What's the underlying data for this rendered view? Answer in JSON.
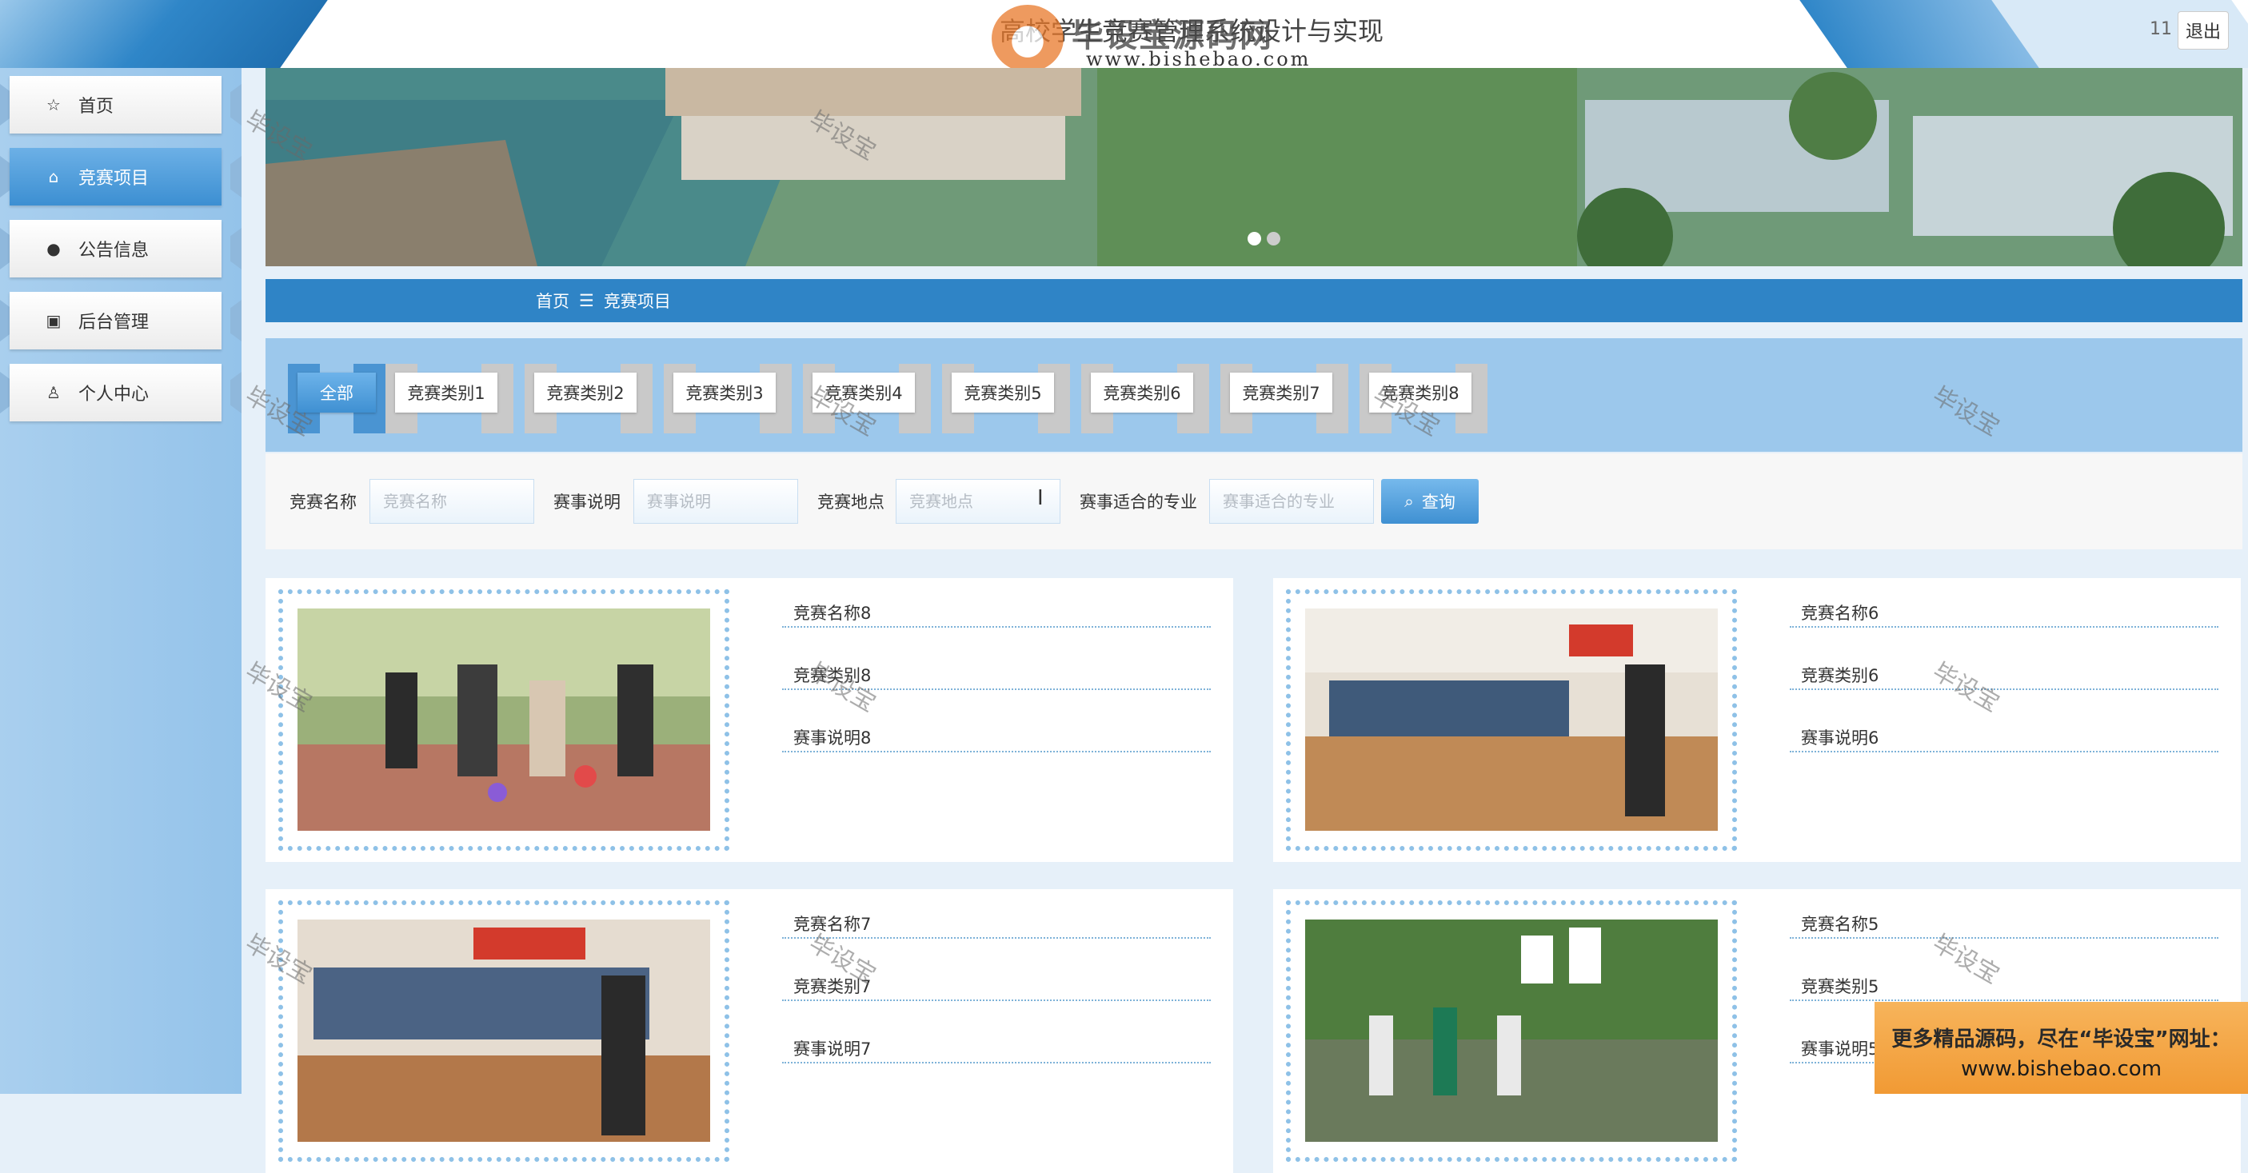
{
  "header": {
    "site_title": "高校学生竞赛管理系统设计与实现",
    "watermark_logo_text": "毕设宝源码网",
    "watermark_url": "www.bishebao.com",
    "user_number": "11",
    "logout_label": "退出"
  },
  "sidebar": {
    "items": [
      {
        "label": "首页",
        "icon": "star-icon"
      },
      {
        "label": "竞赛项目",
        "icon": "bag-icon"
      },
      {
        "label": "公告信息",
        "icon": "alert-icon"
      },
      {
        "label": "后台管理",
        "icon": "briefcase-icon"
      },
      {
        "label": "个人中心",
        "icon": "person-icon"
      }
    ]
  },
  "breadcrumb": {
    "home": "首页",
    "separator": "☰",
    "current": "竞赛项目"
  },
  "categories": [
    "全部",
    "竞赛类别1",
    "竞赛类别2",
    "竞赛类别3",
    "竞赛类别4",
    "竞赛类别5",
    "竞赛类别6",
    "竞赛类别7",
    "竞赛类别8"
  ],
  "search": {
    "name_label": "竞赛名称",
    "name_placeholder": "竞赛名称",
    "desc_label": "赛事说明",
    "desc_placeholder": "赛事说明",
    "place_label": "竞赛地点",
    "place_placeholder": "竞赛地点",
    "major_label": "赛事适合的专业",
    "major_placeholder": "赛事适合的专业",
    "query_label": "查询"
  },
  "cards": [
    {
      "name": "竞赛名称8",
      "category": "竞赛类别8",
      "description": "赛事说明8"
    },
    {
      "name": "竞赛名称6",
      "category": "竞赛类别6",
      "description": "赛事说明6"
    },
    {
      "name": "竞赛名称7",
      "category": "竞赛类别7",
      "description": "赛事说明7"
    },
    {
      "name": "竞赛名称5",
      "category": "竞赛类别5",
      "description": "赛事说明5"
    }
  ],
  "watermark_text": "毕设宝",
  "promo": {
    "line1": "更多精品源码，尽在“毕设宝”网址：",
    "line2": "www.bishebao.com"
  },
  "colors": {
    "accent": "#2f84c6",
    "active": "#3f90d2",
    "promo": "#f19a34"
  }
}
